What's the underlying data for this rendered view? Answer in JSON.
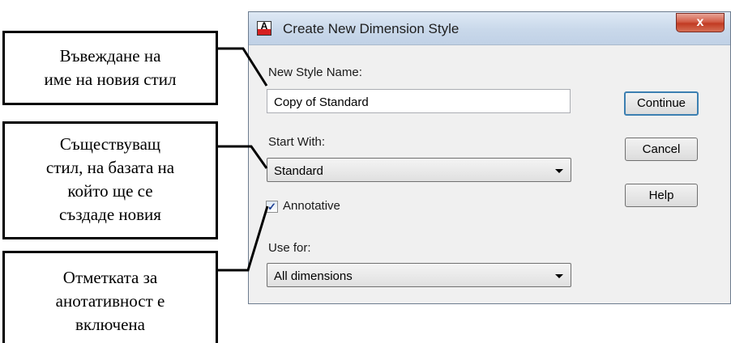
{
  "dialog": {
    "title": "Create New Dimension Style",
    "close_glyph": "x",
    "new_style_name_label": "New Style Name:",
    "new_style_name_value": "Copy of Standard",
    "start_with_label": "Start With:",
    "start_with_value": "Standard",
    "annotative_label": "Annotative",
    "annotative_checked": true,
    "use_for_label": "Use for:",
    "use_for_value": "All dimensions",
    "buttons": {
      "continue": "Continue",
      "cancel": "Cancel",
      "help": "Help"
    }
  },
  "callouts": {
    "name": {
      "line1": "Въвеждане на",
      "line2": "име на новия стил"
    },
    "base": {
      "line1": "Съществуващ",
      "line2": "стил, на базата на",
      "line3": "който ще се",
      "line4": "създаде новия"
    },
    "annotative": {
      "line1": "Отметката за",
      "line2": "анотативност е",
      "line3": "включена"
    }
  },
  "colors": {
    "accent": "#3c7fb1",
    "close_button": "#c13b23",
    "dialog_bg": "#f0f0f0"
  },
  "icons": {
    "app": "autocad-app-icon",
    "close": "close-icon",
    "dropdown": "chevron-down-icon",
    "check": "checkmark-icon"
  }
}
